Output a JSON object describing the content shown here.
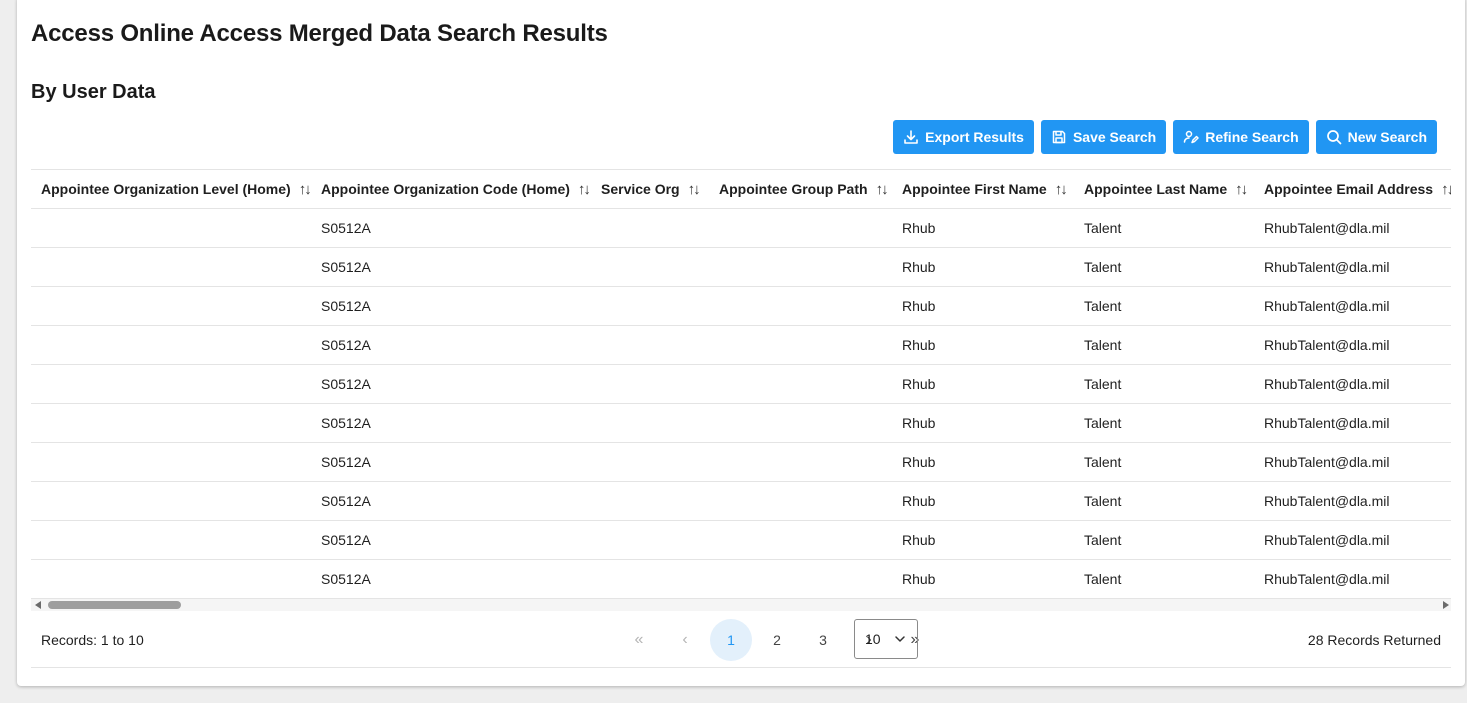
{
  "page": {
    "title": "Access Online Access Merged Data Search Results",
    "section_title": "By User Data"
  },
  "toolbar": {
    "export_label": "Export Results",
    "save_label": "Save Search",
    "refine_label": "Refine Search",
    "new_label": "New Search"
  },
  "table": {
    "columns": [
      "Appointee Organization Level (Home)",
      "Appointee Organization Code (Home)",
      "Service Org",
      "Appointee Group Path",
      "Appointee First Name",
      "Appointee Last Name",
      "Appointee Email Address"
    ],
    "sort_icon": "sort-icon",
    "rows": [
      [
        "",
        "S0512A",
        "",
        "",
        "Rhub",
        "Talent",
        "RhubTalent@dla.mil"
      ],
      [
        "",
        "S0512A",
        "",
        "",
        "Rhub",
        "Talent",
        "RhubTalent@dla.mil"
      ],
      [
        "",
        "S0512A",
        "",
        "",
        "Rhub",
        "Talent",
        "RhubTalent@dla.mil"
      ],
      [
        "",
        "S0512A",
        "",
        "",
        "Rhub",
        "Talent",
        "RhubTalent@dla.mil"
      ],
      [
        "",
        "S0512A",
        "",
        "",
        "Rhub",
        "Talent",
        "RhubTalent@dla.mil"
      ],
      [
        "",
        "S0512A",
        "",
        "",
        "Rhub",
        "Talent",
        "RhubTalent@dla.mil"
      ],
      [
        "",
        "S0512A",
        "",
        "",
        "Rhub",
        "Talent",
        "RhubTalent@dla.mil"
      ],
      [
        "",
        "S0512A",
        "",
        "",
        "Rhub",
        "Talent",
        "RhubTalent@dla.mil"
      ],
      [
        "",
        "S0512A",
        "",
        "",
        "Rhub",
        "Talent",
        "RhubTalent@dla.mil"
      ],
      [
        "",
        "S0512A",
        "",
        "",
        "Rhub",
        "Talent",
        "RhubTalent@dla.mil"
      ]
    ]
  },
  "footer": {
    "records_range": "Records: 1 to 10",
    "records_returned": "28 Records Returned",
    "pages": [
      "1",
      "2",
      "3"
    ],
    "current_page": "1",
    "rows_per_page": "10"
  },
  "colors": {
    "accent": "#2196f3",
    "active_page_bg": "#e3f0fb"
  }
}
